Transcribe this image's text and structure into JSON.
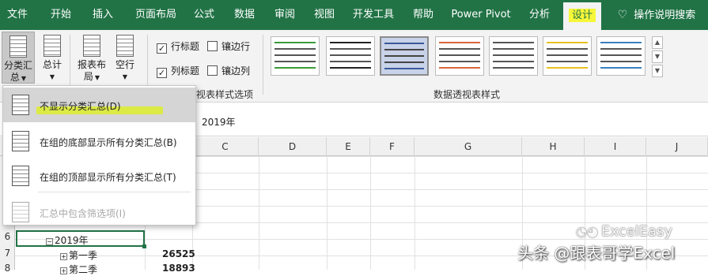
{
  "ribbon_tabs": [
    "文件",
    "开始",
    "插入",
    "页面布局",
    "公式",
    "数据",
    "审阅",
    "视图",
    "开发工具",
    "帮助",
    "Power Pivot",
    "分析",
    "设计",
    "操作说明搜索"
  ],
  "ribbon": {
    "subtotal_label_1": "分类汇",
    "subtotal_label_2": "总",
    "grandtotal_label": "总计",
    "report_layout_label_1": "报表布",
    "report_layout_label_2": "局",
    "blank_rows_label": "空行",
    "row_headers": "行标题",
    "banded_rows": "镶边行",
    "col_headers": "列标题",
    "banded_cols": "镶边列",
    "style_options_group": "视表样式选项",
    "styles_group": "数据透视表样式"
  },
  "formula_bar": {
    "value": "2019年"
  },
  "columns": [
    "C",
    "D",
    "E",
    "F",
    "G",
    "H",
    "I",
    "J"
  ],
  "rows": [
    "6",
    "7",
    "8"
  ],
  "cells": {
    "a6": "2019年",
    "a7": "第一季",
    "b7": "26525",
    "a8": "第二季",
    "b8": "18893"
  },
  "menu": {
    "items": [
      "不显示分类汇总(D)",
      "在组的底部显示所有分类汇总(B)",
      "在组的顶部显示所有分类汇总(T)",
      "汇总中包含筛选项(I)"
    ]
  },
  "watermark": {
    "line1": "ExcelEasy",
    "line2": "头条 @跟表哥学Excel"
  },
  "colors": {
    "ribbon_green": "#217346",
    "highlight_yellow": "#f6f63a"
  }
}
